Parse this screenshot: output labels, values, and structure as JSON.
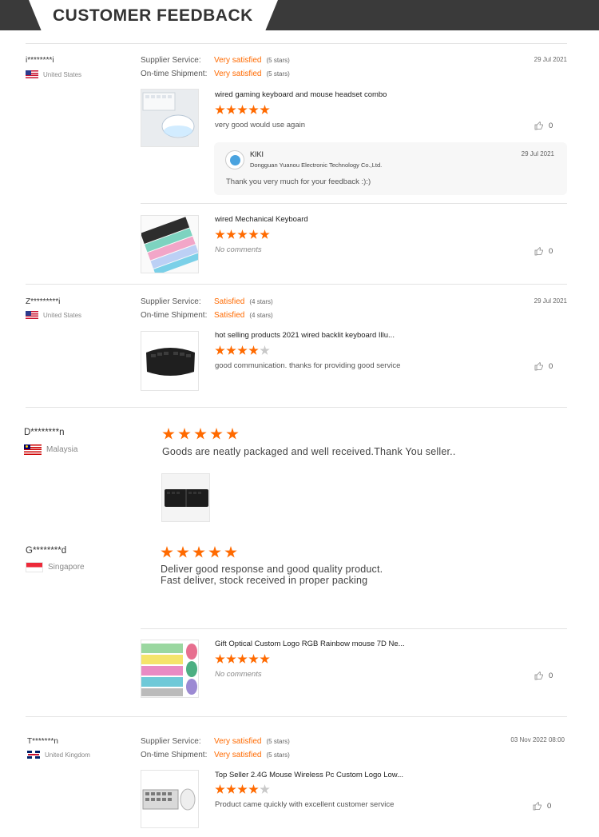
{
  "header": {
    "title": "CUSTOMER FEEDBACK"
  },
  "labels": {
    "supplier_service": "Supplier Service:",
    "ontime_shipment": "On-time Shipment:"
  },
  "reviews": [
    {
      "user": "i********i",
      "country": "United States",
      "supplier_value": "Very satisfied",
      "supplier_stars": "(5 stars)",
      "shipment_value": "Very satisfied",
      "shipment_stars": "(5 stars)",
      "date": "29 Jul 2021",
      "products": [
        {
          "name": "wired gaming keyboard and mouse headset combo",
          "rating": 5,
          "comment": "very good would use again",
          "likes": "0",
          "reply": {
            "name": "KIKI",
            "company": "Dongguan Yuanou Electronic Technology Co.,Ltd.",
            "date": "29 Jul 2021",
            "text": "Thank you very much for your feedback :):)"
          }
        },
        {
          "name": "wired Mechanical Keyboard",
          "rating": 5,
          "comment": "No comments",
          "likes": "0"
        }
      ]
    },
    {
      "user": "Z*********i",
      "country": "United States",
      "supplier_value": "Satisfied",
      "supplier_stars": "(4 stars)",
      "shipment_value": "Satisfied",
      "shipment_stars": "(4 stars)",
      "date": "29 Jul 2021",
      "products": [
        {
          "name": "hot selling products 2021 wired backlit keyboard Illu...",
          "rating": 4,
          "comment": "good communication. thanks for providing good service",
          "likes": "0"
        }
      ]
    },
    {
      "user": "D********n",
      "country": "Malaysia",
      "rating": 5,
      "comment": "Goods are neatly packaged and well received.Thank You seller.."
    },
    {
      "user": "G********d",
      "country": "Singapore",
      "rating": 5,
      "comment_line1": "Deliver good response and good quality product.",
      "comment_line2": "Fast deliver, stock received in proper packing",
      "product": {
        "name": "Gift Optical Custom Logo RGB Rainbow mouse 7D Ne...",
        "rating": 5,
        "comment": "No comments",
        "likes": "0"
      }
    },
    {
      "user": "T*******n",
      "country": "United Kingdom",
      "supplier_value": "Very satisfied",
      "supplier_stars": "(5 stars)",
      "shipment_value": "Very satisfied",
      "shipment_stars": "(5 stars)",
      "date": "03 Nov 2022 08:00",
      "product": {
        "name": "Top Seller 2.4G Mouse Wireless Pc Custom Logo Low...",
        "rating": 4,
        "comment": "Product came quickly with excellent customer service",
        "likes": "0"
      }
    }
  ],
  "colors": {
    "accent": "#ff6a00",
    "banner": "#3a3a3a"
  },
  "icons": {
    "like": "thumbs-up-icon"
  }
}
